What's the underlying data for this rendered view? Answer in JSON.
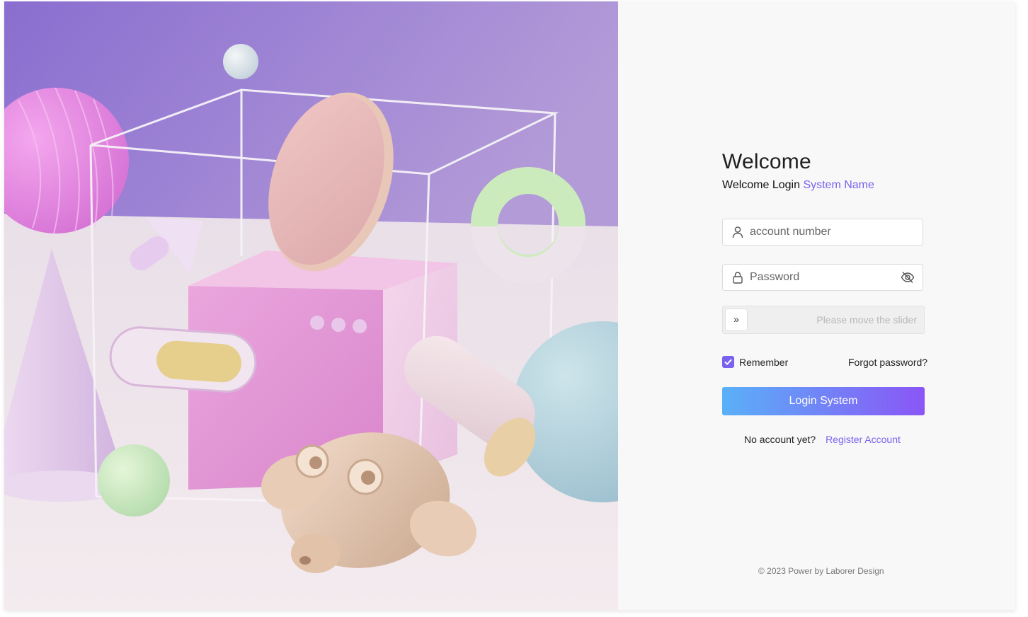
{
  "welcome": {
    "title": "Welcome",
    "subtitle_prefix": "Welcome Login",
    "system_name": "System Name"
  },
  "form": {
    "account_placeholder": "account number",
    "password_placeholder": "Password",
    "slider_hint": "Please move the slider",
    "slider_handle_glyph": "»",
    "remember_label": "Remember",
    "remember_checked": true,
    "forgot_label": "Forgot password?",
    "login_label": "Login System"
  },
  "register": {
    "prompt": "No account yet?",
    "link": "Register Account"
  },
  "footer": {
    "text": "© 2023 Power by Laborer Design"
  },
  "icons": {
    "account": "user-icon",
    "password": "lock-icon",
    "toggle_visibility": "eye-off-icon",
    "slider": "double-chevron-right-icon",
    "checkbox": "check-icon"
  },
  "colors": {
    "accent": "#7b61f0",
    "button_gradient_start": "#5ab0f8",
    "button_gradient_end": "#8a56f6",
    "panel_bg": "#f8f8f8"
  }
}
